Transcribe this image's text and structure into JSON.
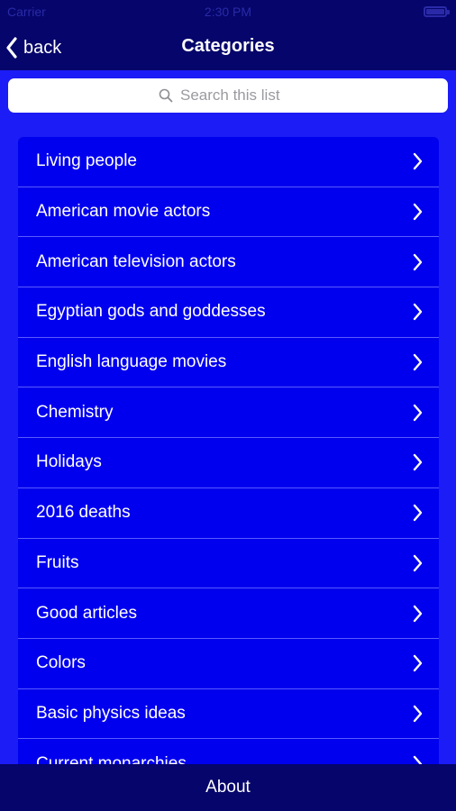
{
  "status_bar": {
    "carrier": "Carrier",
    "time": "2:30 PM"
  },
  "nav": {
    "back_label": "back",
    "title": "Categories"
  },
  "search": {
    "placeholder": "Search this list"
  },
  "categories": [
    {
      "label": "Living people"
    },
    {
      "label": "American movie actors"
    },
    {
      "label": "American television actors"
    },
    {
      "label": "Egyptian gods and goddesses"
    },
    {
      "label": "English language movies"
    },
    {
      "label": "Chemistry"
    },
    {
      "label": "Holidays"
    },
    {
      "label": "2016 deaths"
    },
    {
      "label": "Fruits"
    },
    {
      "label": "Good articles"
    },
    {
      "label": "Colors"
    },
    {
      "label": "Basic physics ideas"
    },
    {
      "label": "Current monarchies"
    }
  ],
  "bottom_bar": {
    "about_label": "About"
  },
  "colors": {
    "bar_background": "#05056b",
    "page_background": "#1c1cf6",
    "row_background": "#0000ee",
    "row_separator": "#5a5aff",
    "text": "#ffffff"
  },
  "icons": {
    "back": "chevron-left-icon",
    "search": "magnifier-icon",
    "row": "chevron-right-icon"
  }
}
